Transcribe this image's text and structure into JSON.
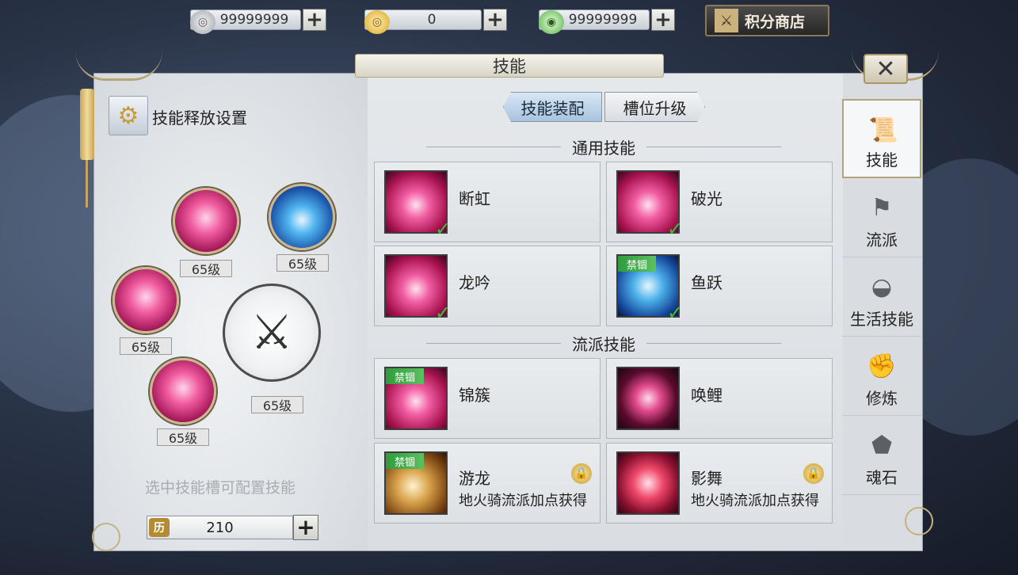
{
  "currency": {
    "silver": {
      "icon": "silver-coin-icon",
      "value": "99999999"
    },
    "gold": {
      "icon": "gold-coin-icon",
      "value": "0"
    },
    "ingot": {
      "icon": "ingot-icon",
      "value": "99999999"
    },
    "plus_symbol": "+"
  },
  "shop": {
    "label": "积分商店",
    "icon": "shop-icon"
  },
  "window": {
    "title": "技能",
    "close_symbol": "✕"
  },
  "left": {
    "settings_label": "技能释放设置",
    "settings_icon": "gear-icon",
    "slots": [
      {
        "level": "65级",
        "style": "pink"
      },
      {
        "level": "65级",
        "style": "blue"
      },
      {
        "level": "65级",
        "style": "pink"
      },
      {
        "level": "65级",
        "style": "pink"
      },
      {
        "level": "65级",
        "style": "weapon"
      }
    ],
    "hint": "选中技能槽可配置技能",
    "points": {
      "icon_text": "历",
      "value": "210",
      "plus": "+"
    }
  },
  "tabs": [
    {
      "label": "技能装配",
      "active": true
    },
    {
      "label": "槽位升级",
      "active": false
    }
  ],
  "sections": {
    "common": "通用技能",
    "school": "流派技能"
  },
  "common_skills": [
    {
      "name": "断虹",
      "equipped": true,
      "banned": false,
      "icon": "ic-pink"
    },
    {
      "name": "破光",
      "equipped": true,
      "banned": false,
      "icon": "ic-pink"
    },
    {
      "name": "龙吟",
      "equipped": true,
      "banned": false,
      "icon": "ic-pink"
    },
    {
      "name": "鱼跃",
      "equipped": true,
      "banned": true,
      "icon": "ic-blue"
    }
  ],
  "school_skills": [
    {
      "name": "锦簇",
      "banned": true,
      "locked": false,
      "sub": "",
      "icon": "ic-pink"
    },
    {
      "name": "唤鲤",
      "banned": false,
      "locked": false,
      "sub": "",
      "icon": "ic-dark"
    },
    {
      "name": "游龙",
      "banned": true,
      "locked": true,
      "sub": "地火骑流派加点获得",
      "icon": "ic-gold"
    },
    {
      "name": "影舞",
      "banned": false,
      "locked": true,
      "sub": "地火骑流派加点获得",
      "icon": "ic-red"
    }
  ],
  "ban_label": "禁锢",
  "check_symbol": "✓",
  "side_nav": [
    {
      "label": "技能",
      "icon": "scroll-icon",
      "active": true
    },
    {
      "label": "流派",
      "icon": "flag-icon",
      "active": false
    },
    {
      "label": "生活技能",
      "icon": "bowl-icon",
      "active": false
    },
    {
      "label": "修炼",
      "icon": "fist-icon",
      "active": false
    },
    {
      "label": "魂石",
      "icon": "stone-icon",
      "active": false
    }
  ],
  "colors": {
    "accent_gold": "#b9a574",
    "equip_check": "#3fbf3a",
    "ban_green": "#2f9c3c"
  }
}
